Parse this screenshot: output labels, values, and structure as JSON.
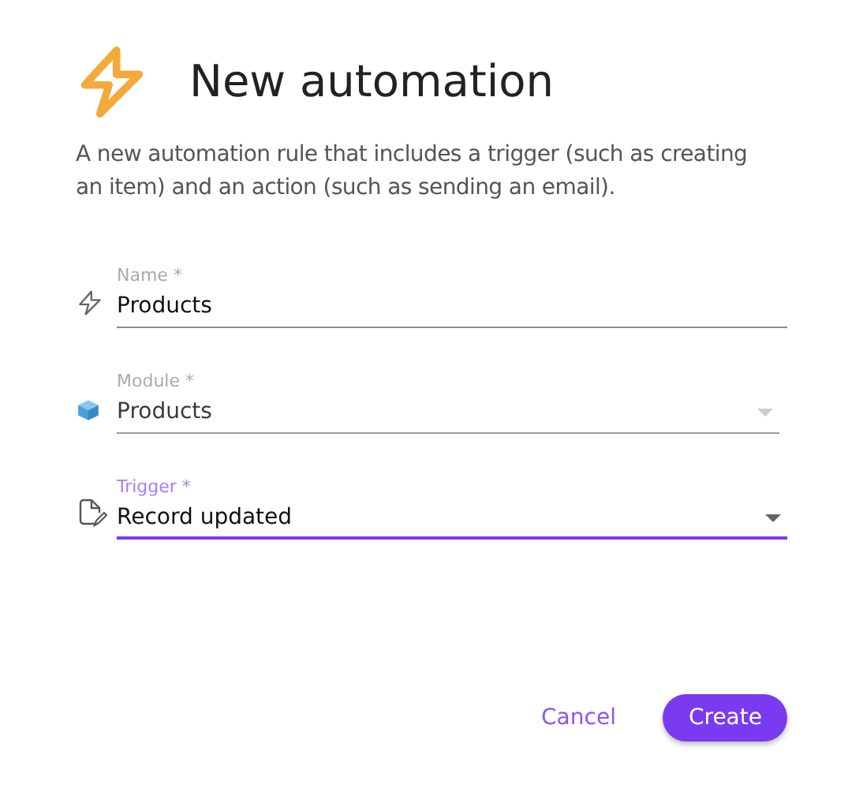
{
  "title": "New automation",
  "description": "A new automation rule that includes a trigger (such as creating an item) and an action (such as sending an email).",
  "fields": [
    {
      "kind": "text",
      "label": "Name *",
      "value": "Products",
      "focused": false,
      "disabled": false
    },
    {
      "kind": "select",
      "label": "Module *",
      "value": "Products",
      "focused": false,
      "disabled": true
    },
    {
      "kind": "select",
      "label": "Trigger *",
      "value": "Record updated",
      "focused": true,
      "disabled": false
    }
  ],
  "buttons": [
    {
      "label": "Cancel",
      "kind": "text"
    },
    {
      "label": "Create",
      "kind": "primary"
    }
  ]
}
